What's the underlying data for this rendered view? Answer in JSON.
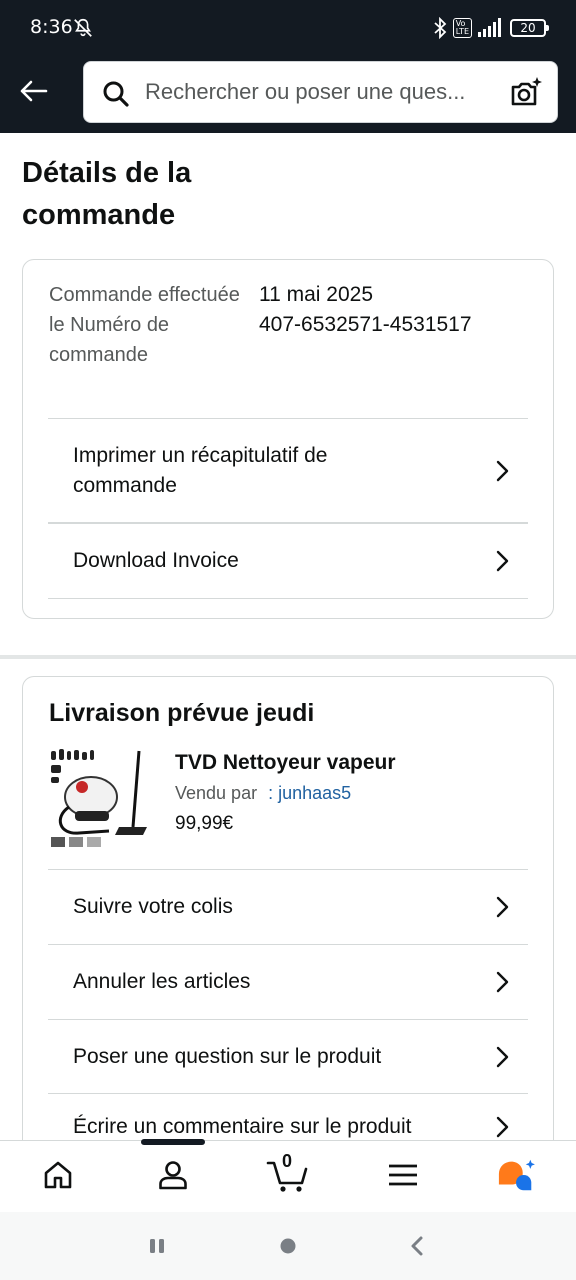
{
  "status_bar": {
    "time": "8:36",
    "battery": "20"
  },
  "search": {
    "placeholder": "Rechercher ou poser une ques..."
  },
  "page": {
    "title": "Détails de la commande"
  },
  "order_summary": {
    "labels": "Commande effectuée le Numéro de commande",
    "date": "11 mai 2025",
    "number": "407-6532571-4531517"
  },
  "order_actions": [
    {
      "label": "Imprimer un récapitulatif de commande"
    },
    {
      "label": "Download Invoice"
    }
  ],
  "delivery": {
    "title": "Livraison prévue jeudi",
    "product": {
      "name": "TVD Nettoyeur vapeur",
      "sold_by_label": "Vendu par",
      "seller": ": junhaas5",
      "price": "99,99€"
    },
    "actions": [
      {
        "label": "Suivre votre colis"
      },
      {
        "label": "Annuler les articles"
      },
      {
        "label": "Poser une question sur le produit"
      },
      {
        "label": "Écrire un commentaire sur le produit"
      }
    ]
  },
  "bottom_nav": {
    "cart_count": "0",
    "items": [
      "home-icon",
      "account-icon",
      "cart-icon",
      "menu-icon",
      "rufus-icon"
    ]
  },
  "colors": {
    "header_bg": "#131a22",
    "link": "#2162a1",
    "rufus_orange": "#ff7a1a",
    "rufus_blue": "#1a73e8"
  }
}
